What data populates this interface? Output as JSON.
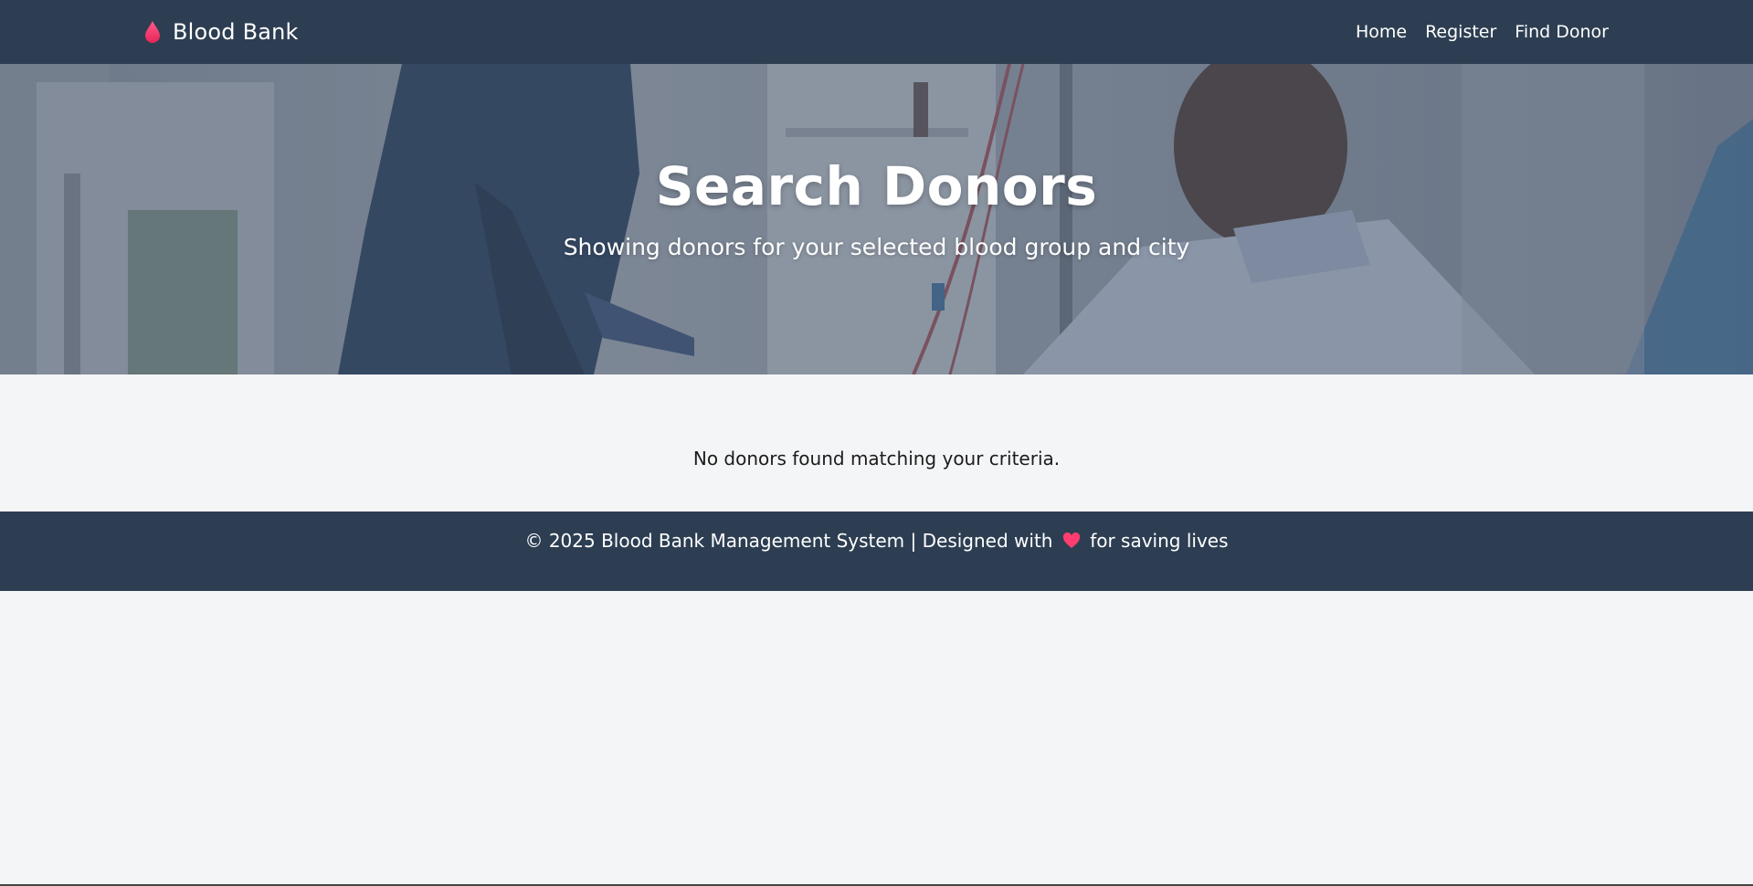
{
  "navbar": {
    "brand": "Blood Bank",
    "links": [
      "Home",
      "Register",
      "Find Donor"
    ]
  },
  "hero": {
    "title": "Search Donors",
    "subtitle": "Showing donors for your selected blood group and city"
  },
  "results": {
    "message": "No donors found matching your criteria."
  },
  "footer": {
    "text_before": "© 2025 Blood Bank Management System | Designed with",
    "text_after": "for saving lives"
  },
  "colors": {
    "nav_bg": "#2d3e52",
    "accent": "#ff3d6e",
    "page_bg": "#f4f5f7"
  },
  "icons": {
    "brand": "blood-drop-icon",
    "footer": "heart-icon"
  }
}
